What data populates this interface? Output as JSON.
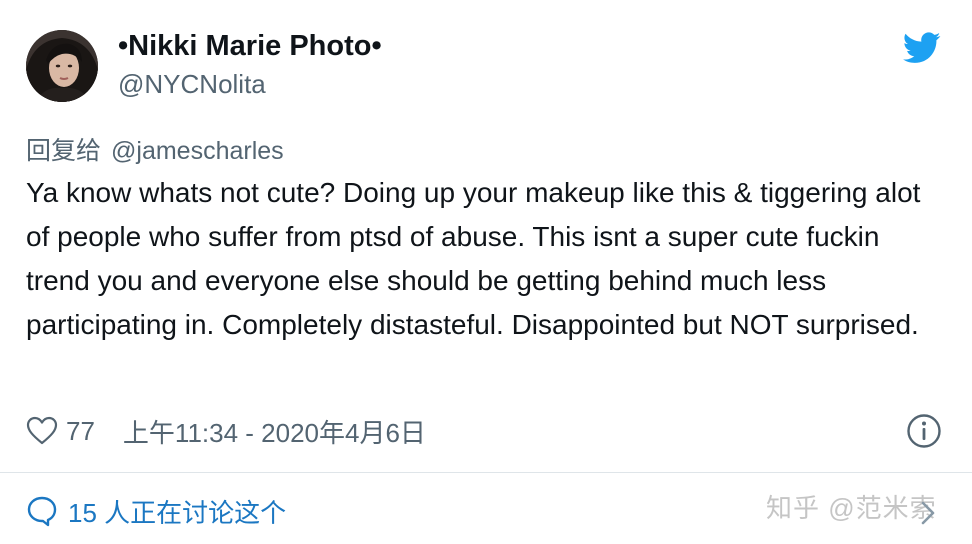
{
  "author": {
    "display_name": "•Nikki Marie Photo•",
    "handle": "@NYCNolita"
  },
  "reply": {
    "label": "回复给",
    "to_handle": "@jamescharles"
  },
  "tweet": {
    "text": "Ya know whats not cute? Doing up your makeup like this & tiggering alot of people who suffer from ptsd of abuse. This isnt a super cute fuckin trend you and everyone else should be getting behind much less participating in. Completely distasteful. Disappointed but NOT surprised."
  },
  "meta": {
    "likes": "77",
    "timestamp": "上午11:34 - 2020年4月6日"
  },
  "discussion": {
    "label": "15 人正在讨论这个"
  },
  "watermark": "知乎 @范米索",
  "icons": {
    "logo": "twitter-bird-icon",
    "like": "heart-icon",
    "info": "info-icon",
    "discussion": "speech-bubble-icon",
    "chevron": "chevron-right-icon"
  },
  "colors": {
    "twitter_blue": "#1da1f2",
    "link_blue": "#1b77c2",
    "text_primary": "#0f1419",
    "text_secondary": "#536471"
  }
}
